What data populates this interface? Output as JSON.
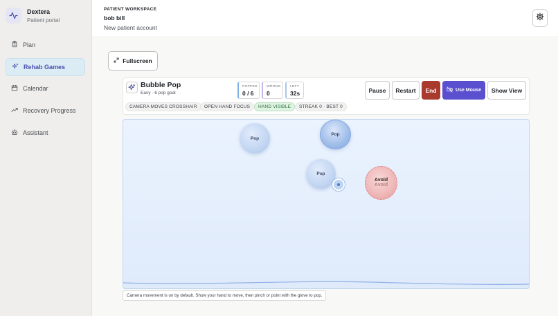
{
  "brand": {
    "name": "Dextera",
    "subtitle": "Patient portal",
    "icon": "activity-icon"
  },
  "sidebar": {
    "items": [
      {
        "label": "Plan",
        "icon": "clipboard-icon",
        "active": false
      },
      {
        "label": "Rehab Games",
        "icon": "sparkles-icon",
        "active": true
      },
      {
        "label": "Calendar",
        "icon": "calendar-icon",
        "active": false
      },
      {
        "label": "Recovery Progress",
        "icon": "trending-up-icon",
        "active": false
      },
      {
        "label": "Assistant",
        "icon": "bot-icon",
        "active": false
      }
    ]
  },
  "header": {
    "eyebrow": "PATIENT WORKSPACE",
    "patient_name": "bob bill",
    "account_label": "New patient account",
    "settings_icon": "gear-icon"
  },
  "main": {
    "fullscreen_label": "Fullscreen"
  },
  "game": {
    "title": "Bubble Pop",
    "subtitle": "Easy · 6 pop goal",
    "stats": {
      "popped_label": "POPPED",
      "popped_value": "0 / 6",
      "wrong_label": "WRONG",
      "wrong_value": "0",
      "left_label": "LEFT",
      "left_value": "32s"
    },
    "buttons": {
      "pause": "Pause",
      "restart": "Restart",
      "end": "End",
      "use_mouse": "Use Mouse",
      "show_view": "Show View"
    },
    "chips": {
      "camera": "CAMERA MOVES CROSSHAIR",
      "focus": "OPEN HAND FOCUS",
      "hand": "HAND VISIBLE",
      "streak": "STREAK 0 · BEST 0"
    },
    "bubbles": {
      "pop_1": "Pop",
      "pop_2": "Pop",
      "pop_3": "Pop",
      "avoid": "Avoid",
      "avoid_shadow": "Avoid"
    },
    "hint": "Camera movement is on by default. Show your hand to move, then pinch or point with the glove to pop."
  },
  "colors": {
    "accent": "#5a4fcf",
    "danger": "#a93a2e",
    "active_nav_bg": "#dcecf4",
    "hand_visible_bg": "#dff3e3"
  }
}
